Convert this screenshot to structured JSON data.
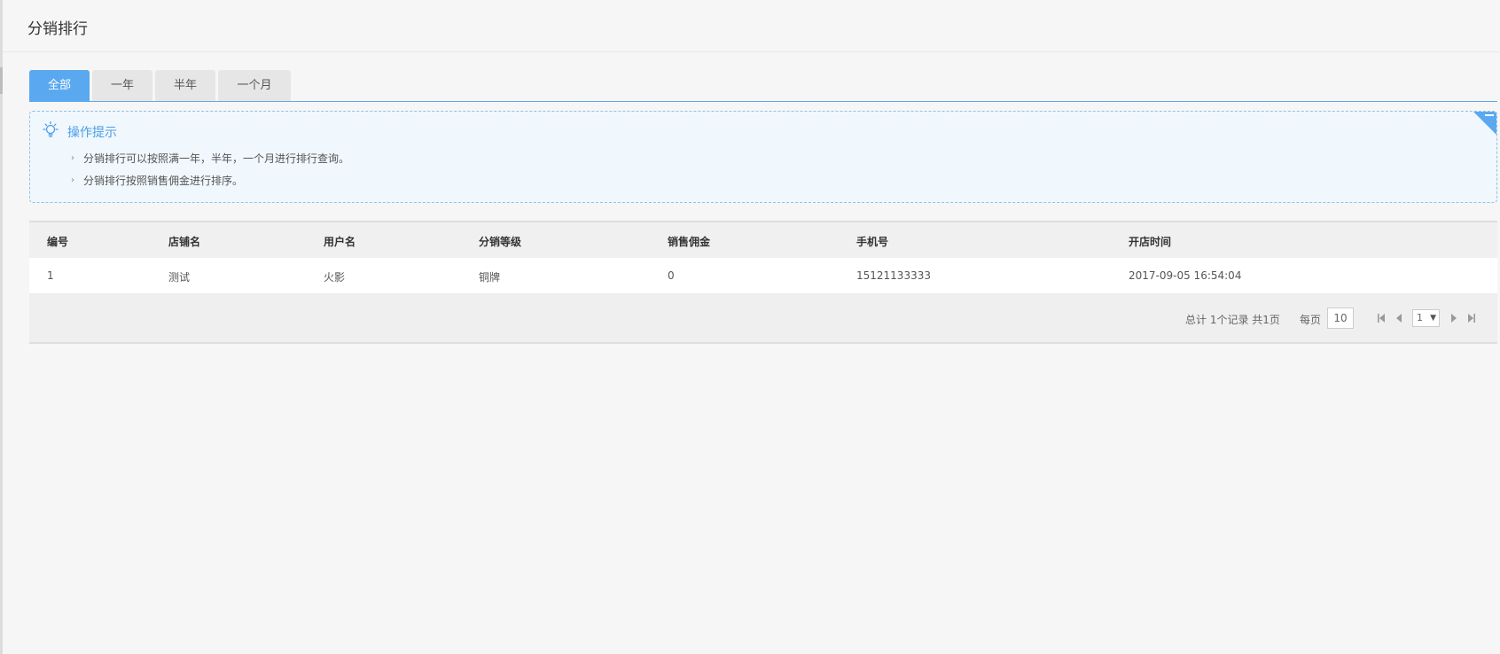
{
  "page": {
    "title": "分销排行"
  },
  "tabs": [
    {
      "label": "全部",
      "active": true
    },
    {
      "label": "一年",
      "active": false
    },
    {
      "label": "半年",
      "active": false
    },
    {
      "label": "一个月",
      "active": false
    }
  ],
  "tips": {
    "title": "操作提示",
    "icon": "lightbulb-icon",
    "items": [
      "分销排行可以按照满一年，半年，一个月进行排行查询。",
      "分销排行按照销售佣金进行排序。"
    ],
    "bullet": "›"
  },
  "table": {
    "columns": [
      "编号",
      "店铺名",
      "用户名",
      "分销等级",
      "销售佣金",
      "手机号",
      "开店时间"
    ],
    "rows": [
      [
        "1",
        "测试",
        "火影",
        "铜牌",
        "0",
        "15121133333",
        "2017-09-05 16:54:04"
      ]
    ]
  },
  "pager": {
    "summary": "总计 1个记录 共1页",
    "per_page_label": "每页",
    "per_page": "10",
    "current_page": "1",
    "caret": "▼"
  },
  "colors": {
    "accent": "#5aa8f0",
    "tips_bg": "#f0f7fd",
    "page_bg": "#f6f6f6"
  }
}
